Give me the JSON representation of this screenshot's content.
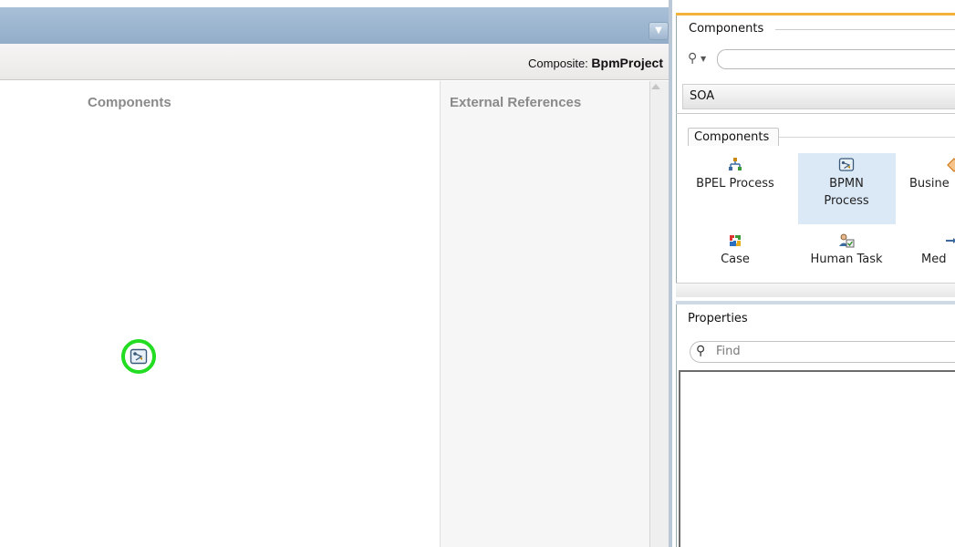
{
  "editor": {
    "composite_prefix": "Composite:",
    "composite_name": "BpmProject",
    "components_heading": "Components",
    "external_references_heading": "External References"
  },
  "palette": {
    "title": "Components",
    "search_placeholder": "",
    "category_selected": "SOA",
    "group_label": "Components",
    "items": [
      {
        "label_line1": "BPEL Process",
        "label_line2": "",
        "icon": "bpel-process-icon"
      },
      {
        "label_line1": "BPMN",
        "label_line2": "Process",
        "icon": "bpmn-process-icon",
        "selected": true
      },
      {
        "label_line1": "Busine",
        "label_line2": "",
        "icon": "business-rule-icon"
      },
      {
        "label_line1": "Case",
        "label_line2": "",
        "icon": "case-icon"
      },
      {
        "label_line1": "Human Task",
        "label_line2": "",
        "icon": "human-task-icon"
      },
      {
        "label_line1": "Med",
        "label_line2": "",
        "icon": "mediator-icon"
      }
    ]
  },
  "properties": {
    "title": "Properties",
    "find_placeholder": "Find"
  },
  "colors": {
    "header_blue": "#9ab4cf",
    "selection_ring": "#22dd22",
    "tile_selected": "#dbe9f7",
    "panel_accent": "#f2b23a"
  }
}
